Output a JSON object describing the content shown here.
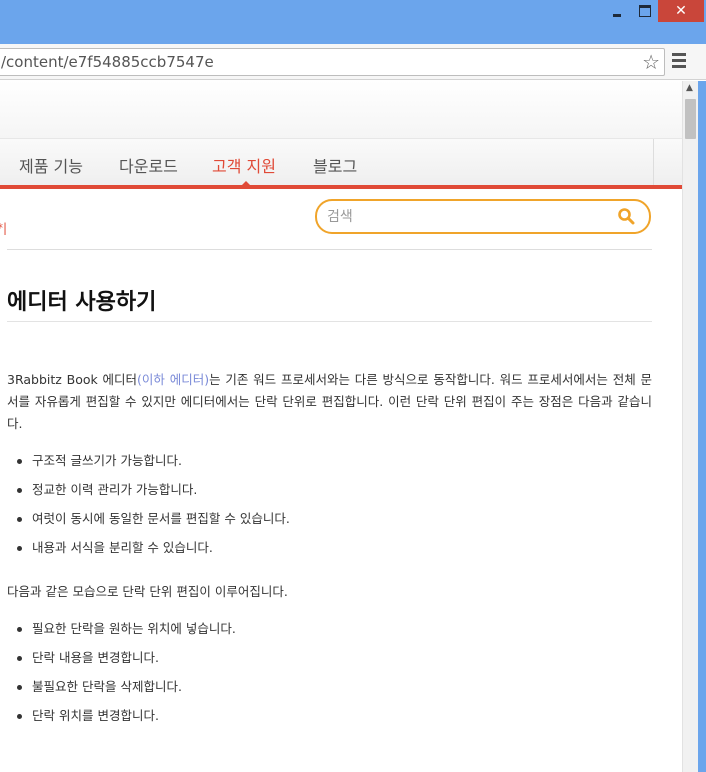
{
  "window": {
    "close_glyph": "✕"
  },
  "browser": {
    "url": "/content/e7f54885ccb7547e",
    "star_glyph": "☆"
  },
  "nav": {
    "items": [
      "제품 기능",
      "다운로드",
      "고객 지원",
      "블로그"
    ],
    "active_index": 2,
    "accent_color": "#e04a37"
  },
  "breadcrumb_fragment": "*|",
  "search": {
    "placeholder": "검색",
    "border_color": "#f0a42a"
  },
  "article": {
    "title": "에디터 사용하기",
    "intro_pre": "3Rabbitz Book 에디터",
    "intro_link": "(이하 에디터)",
    "intro_post": "는 기존 워드 프로세서와는 다른 방식으로 동작합니다. 워드 프로세서에서는 전체 문서를 자유롭게 편집할 수 있지만 에디터에서는 단락 단위로 편집합니다. 이런 단락 단위 편집이 주는 장점은 다음과 같습니다.",
    "benefits": [
      "구조적 글쓰기가 가능합니다.",
      "정교한 이력 관리가 가능합니다.",
      "여럿이 동시에 동일한 문서를 편집할 수 있습니다.",
      "내용과 서식을 분리할 수 있습니다."
    ],
    "para2": "다음과 같은 모습으로 단락 단위 편집이 이루어집니다.",
    "steps": [
      "필요한 단락을 원하는 위치에 넣습니다.",
      "단락 내용을 변경합니다.",
      "불필요한 단락을 삭제합니다.",
      "단락 위치를 변경합니다."
    ]
  }
}
